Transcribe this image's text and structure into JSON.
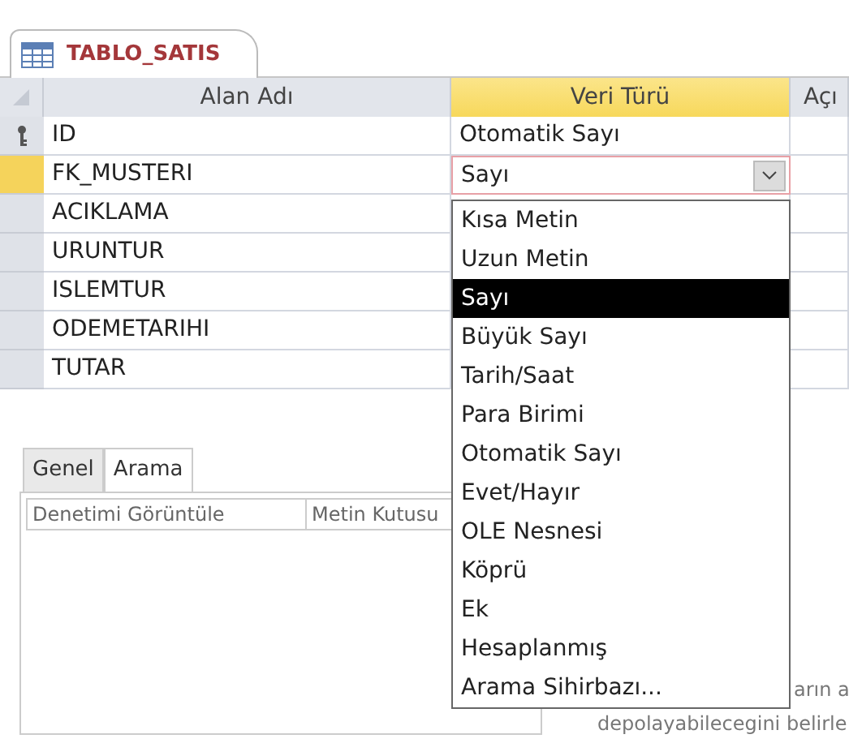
{
  "document_tab": {
    "title": "TABLO_SATIS"
  },
  "columns": [
    {
      "label": "Alan Adı",
      "highlighted": false
    },
    {
      "label": "Veri Türü",
      "highlighted": true
    },
    {
      "label": "Açı",
      "highlighted": false
    }
  ],
  "fields": [
    {
      "name": "ID",
      "data_type": "Otomatik Sayı",
      "primary_key": true,
      "selected": false
    },
    {
      "name": "FK_MUSTERI",
      "data_type": "Sayı",
      "primary_key": false,
      "selected": true
    },
    {
      "name": "ACIKLAMA",
      "primary_key": false,
      "selected": false
    },
    {
      "name": "URUNTUR",
      "primary_key": false,
      "selected": false
    },
    {
      "name": "ISLEMTUR",
      "primary_key": false,
      "selected": false
    },
    {
      "name": "ODEMETARIHI",
      "primary_key": false,
      "selected": false
    },
    {
      "name": "TUTAR",
      "primary_key": false,
      "selected": false
    }
  ],
  "dropdown_options": [
    {
      "label": "Kısa Metin",
      "selected": false
    },
    {
      "label": "Uzun Metin",
      "selected": false
    },
    {
      "label": "Sayı",
      "selected": true
    },
    {
      "label": "Büyük Sayı",
      "selected": false
    },
    {
      "label": "Tarih/Saat",
      "selected": false
    },
    {
      "label": "Para Birimi",
      "selected": false
    },
    {
      "label": "Otomatik Sayı",
      "selected": false
    },
    {
      "label": "Evet/Hayır",
      "selected": false
    },
    {
      "label": "OLE Nesnesi",
      "selected": false
    },
    {
      "label": "Köprü",
      "selected": false
    },
    {
      "label": "Ek",
      "selected": false
    },
    {
      "label": "Hesaplanmış",
      "selected": false
    },
    {
      "label": "Arama Sihirbazı...",
      "selected": false
    }
  ],
  "property_tabs": [
    {
      "label": "Genel",
      "selected": false
    },
    {
      "label": "Arama",
      "selected": true
    }
  ],
  "properties": [
    {
      "label": "Denetimi Görüntüle",
      "value": "Metin Kutusu"
    }
  ],
  "help_text": [
    "arın a",
    "depolayabilecegini belirle"
  ]
}
